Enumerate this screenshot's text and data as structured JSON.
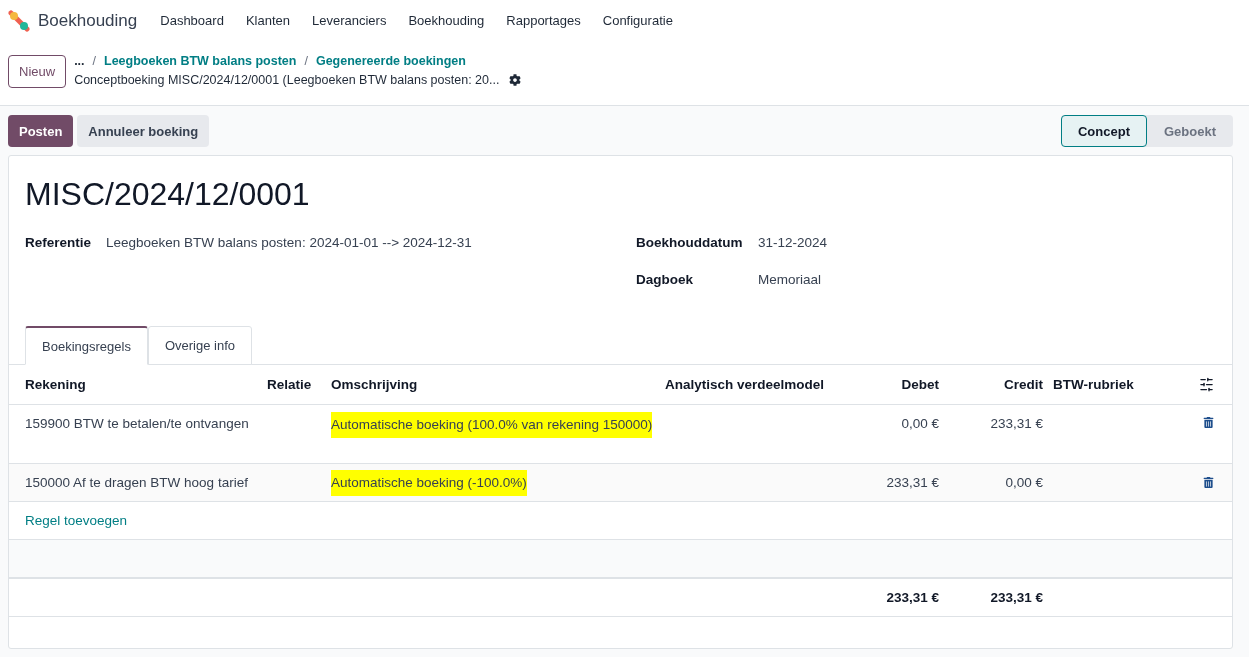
{
  "app": {
    "name": "Boekhouding"
  },
  "menu": [
    "Dashboard",
    "Klanten",
    "Leveranciers",
    "Boekhouding",
    "Rapportages",
    "Configuratie"
  ],
  "new_button": "Nieuw",
  "breadcrumbs": [
    {
      "separator": "/",
      "label": "Leegboeken BTW balans posten"
    },
    {
      "separator": "/",
      "label": "Gegenereerde boekingen"
    }
  ],
  "breadcrumb_more": "...",
  "record_title": "Conceptboeking MISC/2024/12/0001 (Leegboeken BTW balans posten: 20...",
  "actions": [
    {
      "label": "Posten",
      "kind": "primary"
    },
    {
      "label": "Annuleer boeking",
      "kind": "secondary"
    }
  ],
  "statusbar": [
    {
      "label": "Concept",
      "selected": true
    },
    {
      "label": "Geboekt",
      "selected": false
    }
  ],
  "entry": {
    "name": "MISC/2024/12/0001",
    "left_fields": [
      {
        "label": "Referentie",
        "value": "Leegboeken BTW balans posten: 2024-01-01 --> 2024-12-31"
      }
    ],
    "right_fields": [
      {
        "label": "Boekhouddatum",
        "value": "31-12-2024"
      },
      {
        "label": "Dagboek",
        "value": "Memoriaal"
      }
    ]
  },
  "tabs": [
    {
      "label": "Boekingsregels",
      "selected": true
    },
    {
      "label": "Overige info",
      "selected": false
    }
  ],
  "table": {
    "columns": [
      "Rekening",
      "Relatie",
      "Omschrijving",
      "Analytisch verdeelmodel",
      "Debet",
      "Credit",
      "BTW-rubriek"
    ],
    "rows": [
      {
        "account": "159900 BTW te betalen/te ontvangen",
        "description": "Automatische boeking (100.0% van rekening 150000)",
        "highlighted": true,
        "debit": "0,00 €",
        "credit": "233,31 €"
      },
      {
        "account": "150000 Af te dragen BTW hoog tarief",
        "description": "Automatische boeking (-100.0%)",
        "highlighted": true,
        "debit": "233,31 €",
        "credit": "0,00 €"
      }
    ],
    "add_line": "Regel toevoegen",
    "totals": {
      "debit": "233,31 €",
      "credit": "233,31 €"
    }
  }
}
